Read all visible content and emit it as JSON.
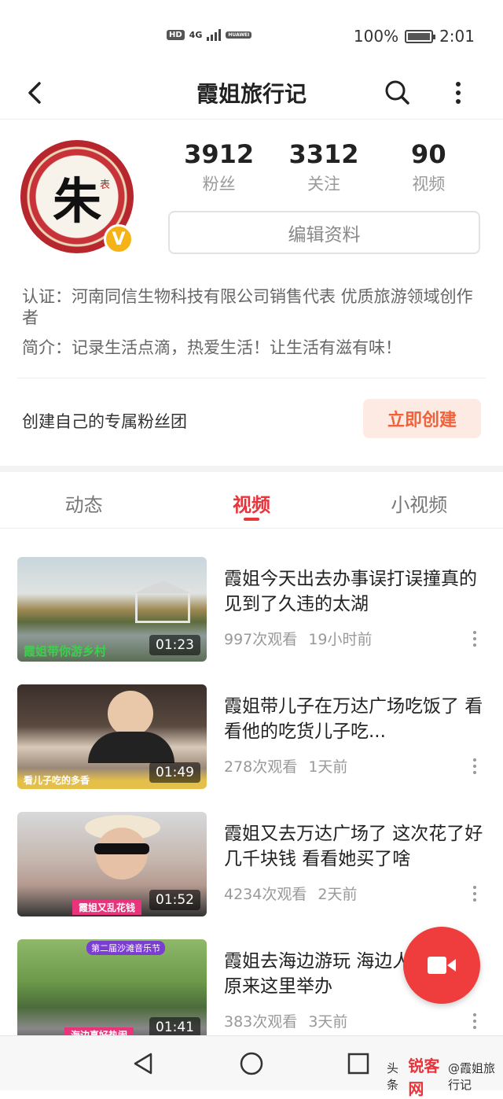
{
  "status_bar": {
    "hd_label": "HD",
    "network": "4G",
    "carrier_badge": "HUAWEI",
    "battery_text": "100%",
    "battery_level": 1.0,
    "time": "2:01"
  },
  "header": {
    "title": "霞姐旅行记",
    "back_icon": "chevron-left-icon",
    "search_icon": "search-icon",
    "more_icon": "more-vertical-icon"
  },
  "profile": {
    "avatar_char": "朱",
    "avatar_sub": "表",
    "verified_badge": "V",
    "stats": [
      {
        "value": "3912",
        "label": "粉丝"
      },
      {
        "value": "3312",
        "label": "关注"
      },
      {
        "value": "90",
        "label": "视频"
      }
    ],
    "edit_button": "编辑资料",
    "certification": "认证：河南同信生物科技有限公司销售代表 优质旅游领域创作者",
    "intro": "简介：记录生活点滴，热爱生活！让生活有滋有味！",
    "fan_club_text": "创建自己的专属粉丝团",
    "fan_club_button": "立即创建"
  },
  "tabs": [
    {
      "label": "动态",
      "active": false
    },
    {
      "label": "视频",
      "active": true
    },
    {
      "label": "小视频",
      "active": false
    }
  ],
  "videos": [
    {
      "title": "霞姐今天出去办事误打误撞真的见到了久违的太湖",
      "views": "997次观看",
      "time": "19小时前",
      "duration": "01:23",
      "caption": "霞姐带你游乡村"
    },
    {
      "title": "霞姐带儿子在万达广场吃饭了 看看他的吃货儿子吃...",
      "views": "278次观看",
      "time": "1天前",
      "duration": "01:49",
      "caption": "看儿子吃的多香"
    },
    {
      "title": "霞姐又去万达广场了 这次花了好几千块钱 看看她买了啥",
      "views": "4234次观看",
      "time": "2天前",
      "duration": "01:52",
      "caption": "霞姐又乱花钱"
    },
    {
      "title": "霞姐去海边游玩 海边人山人海 原来这里举办",
      "views": "383次观看",
      "time": "3天前",
      "duration": "01:41",
      "caption": "海边真好热闹",
      "banner": "第二届沙滩音乐节"
    }
  ],
  "fab": {
    "icon": "video-camera-icon"
  },
  "nav": {
    "back_icon": "triangle-back-icon",
    "home_icon": "circle-home-icon",
    "recent_icon": "square-recent-icon"
  },
  "watermark": {
    "prefix": "头条",
    "logo": "锐客网",
    "name": "@霞姐旅行记"
  },
  "colors": {
    "accent": "#e8343a",
    "fab": "#ef3c3c",
    "fan_button_bg": "#fdeae2",
    "fan_button_text": "#f0623a",
    "verified": "#f5b315"
  }
}
